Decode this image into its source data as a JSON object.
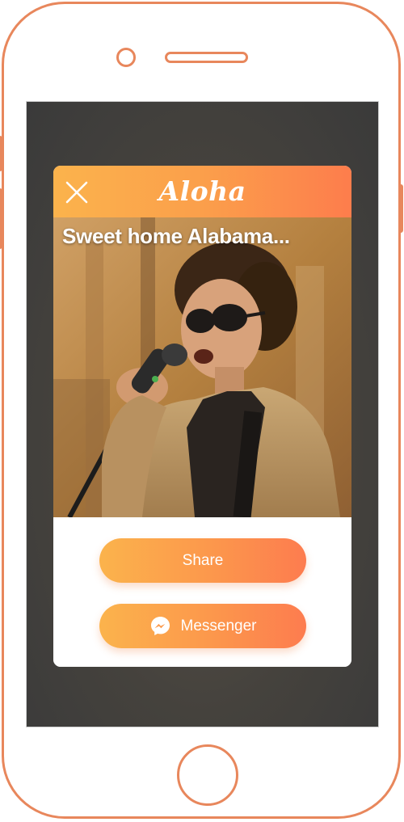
{
  "app": {
    "brand_name": "Aloha"
  },
  "dialog": {
    "caption": "Sweet home Alabama...",
    "actions": {
      "share_label": "Share",
      "messenger_label": "Messenger"
    }
  },
  "icons": {
    "close": "close-icon",
    "messenger": "messenger-icon"
  },
  "colors": {
    "accent_start": "#fbb34c",
    "accent_end": "#fd7c4f",
    "device_outline": "#e8875c",
    "screen_background": "#45423d"
  }
}
